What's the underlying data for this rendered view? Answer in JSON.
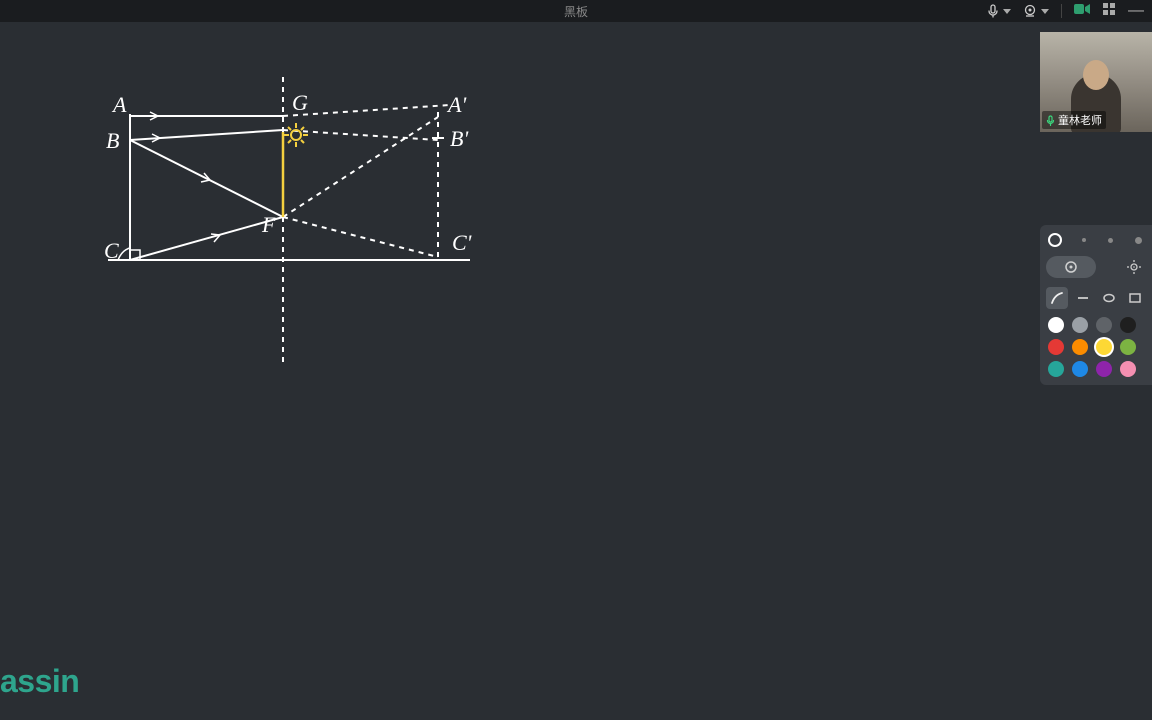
{
  "titlebar": {
    "title": "黑板",
    "mic_icon": "mic",
    "cam_icon": "cam",
    "video_icon": "video",
    "grid_icon": "grid"
  },
  "video": {
    "username": "童林老师"
  },
  "toolbox": {
    "stroke_sizes": [
      "xs",
      "s",
      "m",
      "l"
    ],
    "tools": {
      "pen": "pen",
      "line": "line",
      "ellipse": "ellipse",
      "rect": "rect"
    },
    "colors_row1": [
      "#ffffff",
      "#9aa0a6",
      "#5f6368",
      "#1f1f1f"
    ],
    "colors_row2": [
      "#e53935",
      "#fb8c00",
      "#fdd835",
      "#7cb342"
    ],
    "colors_row3": [
      "#26a69a",
      "#1e88e5",
      "#8e24aa",
      "#f48fb1"
    ]
  },
  "watermark": "assin",
  "geometry": {
    "labels": [
      "A",
      "B",
      "C",
      "G",
      "F",
      "A'",
      "B'",
      "C'"
    ]
  }
}
